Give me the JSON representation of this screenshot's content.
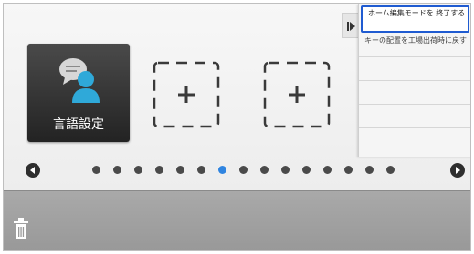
{
  "home": {
    "tiles": [
      {
        "label": "言語設定",
        "icon": "language-settings-icon"
      }
    ],
    "empty_slots": [
      {
        "icon": "add-shortcut-icon"
      },
      {
        "icon": "add-shortcut-icon"
      }
    ]
  },
  "pager": {
    "page_count": 15,
    "active_page": 6,
    "active_color": "#2f84e0"
  },
  "menu": {
    "items": [
      {
        "label": "ホーム編集モードを 終了する"
      },
      {
        "label": "キーの配置を工場出荷時に戻す"
      }
    ]
  },
  "bottom_bar": {
    "trash_icon": "trash-icon"
  }
}
